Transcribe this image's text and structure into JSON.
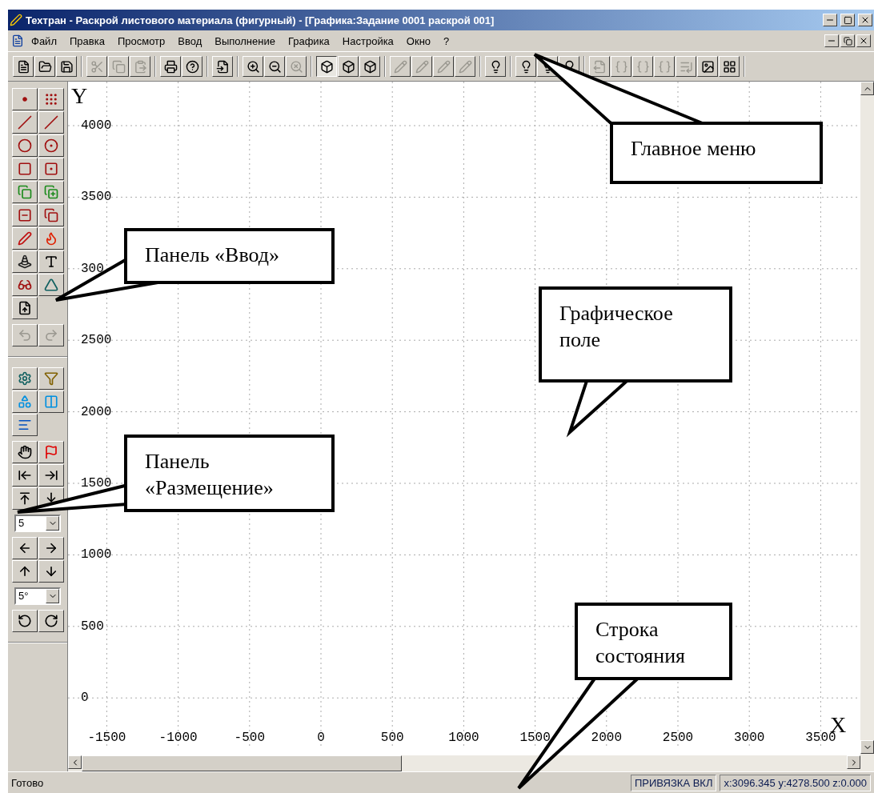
{
  "window": {
    "title": "Техтран - Раскрой листового материала (фигурный) - [Графика:Задание 0001 раскрой 001]"
  },
  "menu": [
    {
      "label": "Файл"
    },
    {
      "label": "Правка"
    },
    {
      "label": "Просмотр"
    },
    {
      "label": "Ввод"
    },
    {
      "label": "Выполнение"
    },
    {
      "label": "Графика"
    },
    {
      "label": "Настройка"
    },
    {
      "label": "Окно"
    },
    {
      "label": "?"
    }
  ],
  "toolbar": [
    [
      {
        "disabled": false,
        "pressed": false
      },
      {
        "disabled": false,
        "pressed": false
      },
      {
        "disabled": false,
        "pressed": false
      }
    ],
    [
      {
        "disabled": true,
        "pressed": false
      },
      {
        "disabled": true,
        "pressed": false
      },
      {
        "disabled": true,
        "pressed": false
      }
    ],
    [
      {
        "disabled": false,
        "pressed": false
      },
      {
        "disabled": false,
        "pressed": false
      }
    ],
    [
      {
        "disabled": false,
        "pressed": false
      }
    ],
    [
      {
        "disabled": false,
        "pressed": false
      },
      {
        "disabled": false,
        "pressed": false
      },
      {
        "disabled": true,
        "pressed": false
      }
    ],
    [
      {
        "disabled": false,
        "pressed": true
      },
      {
        "disabled": false,
        "pressed": false
      },
      {
        "disabled": false,
        "pressed": false
      }
    ],
    [
      {
        "disabled": true,
        "pressed": false
      },
      {
        "disabled": true,
        "pressed": false
      },
      {
        "disabled": true,
        "pressed": false
      },
      {
        "disabled": true,
        "pressed": false
      }
    ],
    [
      {
        "disabled": false,
        "pressed": false
      }
    ],
    [
      {
        "disabled": false,
        "pressed": false
      },
      {
        "disabled": false,
        "pressed": false
      },
      {
        "disabled": false,
        "pressed": false
      }
    ],
    [
      {
        "disabled": true,
        "pressed": false
      },
      {
        "disabled": true,
        "pressed": false
      },
      {
        "disabled": true,
        "pressed": false
      },
      {
        "disabled": true,
        "pressed": false
      },
      {
        "disabled": true,
        "pressed": false
      },
      {
        "disabled": false,
        "pressed": false
      },
      {
        "disabled": false,
        "pressed": false
      }
    ]
  ],
  "left_panel": {
    "input_tools": [
      {
        "disabled": false
      },
      {
        "disabled": false
      },
      {
        "disabled": false
      },
      {
        "disabled": false
      },
      {
        "disabled": false
      },
      {
        "disabled": false
      },
      {
        "disabled": false
      },
      {
        "disabled": false
      },
      {
        "disabled": false
      },
      {
        "disabled": false
      },
      {
        "disabled": false
      },
      {
        "disabled": false
      },
      {
        "disabled": false
      },
      {
        "disabled": false
      },
      {
        "disabled": false
      },
      {
        "disabled": false
      },
      {
        "disabled": false
      },
      {
        "disabled": false
      },
      {
        "disabled": false
      }
    ],
    "history": [
      {
        "disabled": true
      },
      {
        "disabled": true
      }
    ],
    "placement_tools": [
      {
        "disabled": false
      },
      {
        "disabled": false
      },
      {
        "disabled": false
      },
      {
        "disabled": false
      },
      {
        "disabled": false
      },
      {
        "disabled": false
      },
      {
        "disabled": false
      },
      {
        "disabled": false
      },
      {
        "disabled": false
      },
      {
        "disabled": false
      },
      {
        "disabled": false
      }
    ],
    "step": {
      "value": "5"
    },
    "move_tools": [
      {
        "disabled": false
      },
      {
        "disabled": false
      },
      {
        "disabled": false
      },
      {
        "disabled": false
      }
    ],
    "angle": {
      "value": "5°"
    },
    "rotate_tools": [
      {
        "disabled": false
      },
      {
        "disabled": false
      }
    ]
  },
  "canvas": {
    "y_axis": "Y",
    "x_axis": "X",
    "y_ticks": [
      "4000",
      "3500",
      "300",
      "2500",
      "2000",
      "1500",
      "1000",
      "500",
      "0"
    ],
    "x_ticks": [
      "-1500",
      "-1000",
      "-500",
      "0",
      "500",
      "1000",
      "1500",
      "2000",
      "2500",
      "3000",
      "3500"
    ]
  },
  "status_bar": {
    "message": "Готово",
    "snap": "ПРИВЯЗКА ВКЛ",
    "coordinates": "x:3096.345 y:4278.500 z:0.000"
  },
  "callouts": [
    {
      "text": "Главное меню"
    },
    {
      "text": "Панель «Ввод»"
    },
    {
      "text": "Графическое поле"
    },
    {
      "text": "Панель «Размещение»"
    },
    {
      "text": "Строка состояния"
    }
  ]
}
